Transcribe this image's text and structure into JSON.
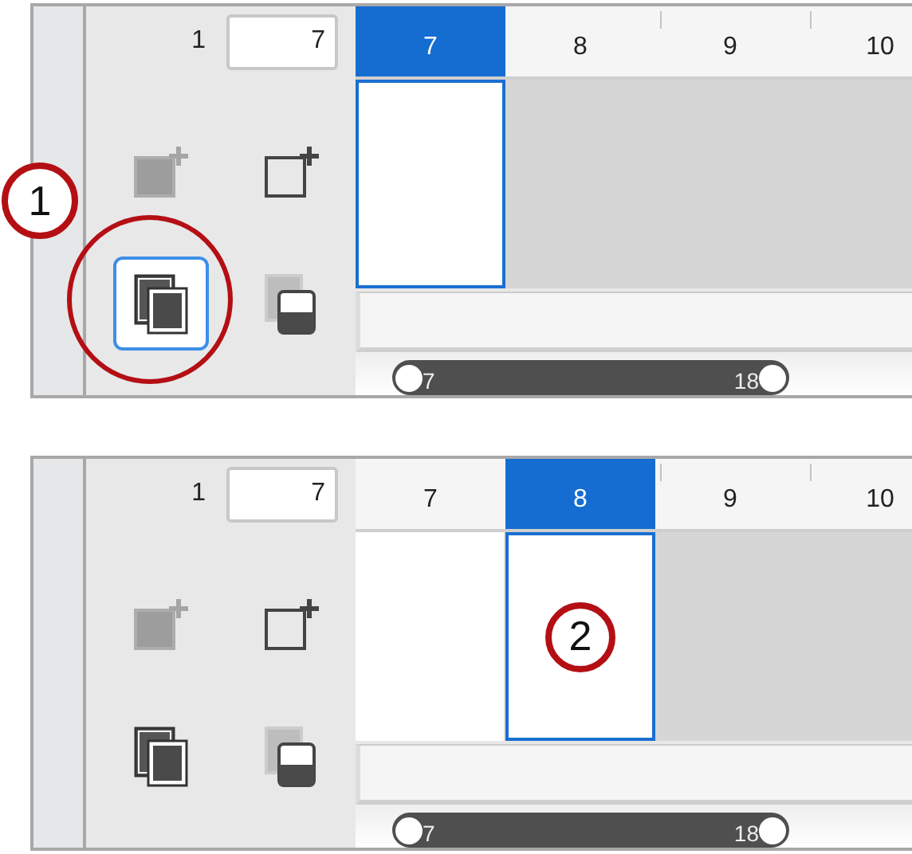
{
  "panels": [
    {
      "frame_count_label": "1",
      "current_frame": "7",
      "tools": [
        {
          "kind": "add-frame",
          "disabled": true,
          "selected": false
        },
        {
          "kind": "new-frame",
          "disabled": false,
          "selected": false
        },
        {
          "kind": "onion-skin",
          "disabled": false,
          "selected": true
        },
        {
          "kind": "mask",
          "disabled": false,
          "selected": false
        }
      ],
      "frames": [
        {
          "label": "7",
          "selected": true,
          "filled": true
        },
        {
          "label": "8",
          "selected": false,
          "filled": false
        },
        {
          "label": "9",
          "selected": false,
          "filled": false
        },
        {
          "label": "10",
          "selected": false,
          "filled": false
        }
      ],
      "range": {
        "start": "7",
        "end": "18",
        "level": 1
      },
      "callout": {
        "number": "1",
        "kind": "ring"
      }
    },
    {
      "frame_count_label": "1",
      "current_frame": "7",
      "tools": [
        {
          "kind": "add-frame",
          "disabled": true,
          "selected": false
        },
        {
          "kind": "new-frame",
          "disabled": false,
          "selected": false
        },
        {
          "kind": "onion-skin",
          "disabled": false,
          "selected": false
        },
        {
          "kind": "mask",
          "disabled": false,
          "selected": false
        }
      ],
      "frames": [
        {
          "label": "7",
          "selected": false,
          "filled": true
        },
        {
          "label": "8",
          "selected": true,
          "filled": true
        },
        {
          "label": "9",
          "selected": false,
          "filled": false
        },
        {
          "label": "10",
          "selected": false,
          "filled": false
        }
      ],
      "range": {
        "start": "7",
        "end": "18",
        "level": 1
      },
      "callout": {
        "number": "2",
        "kind": "in-frame"
      }
    }
  ]
}
